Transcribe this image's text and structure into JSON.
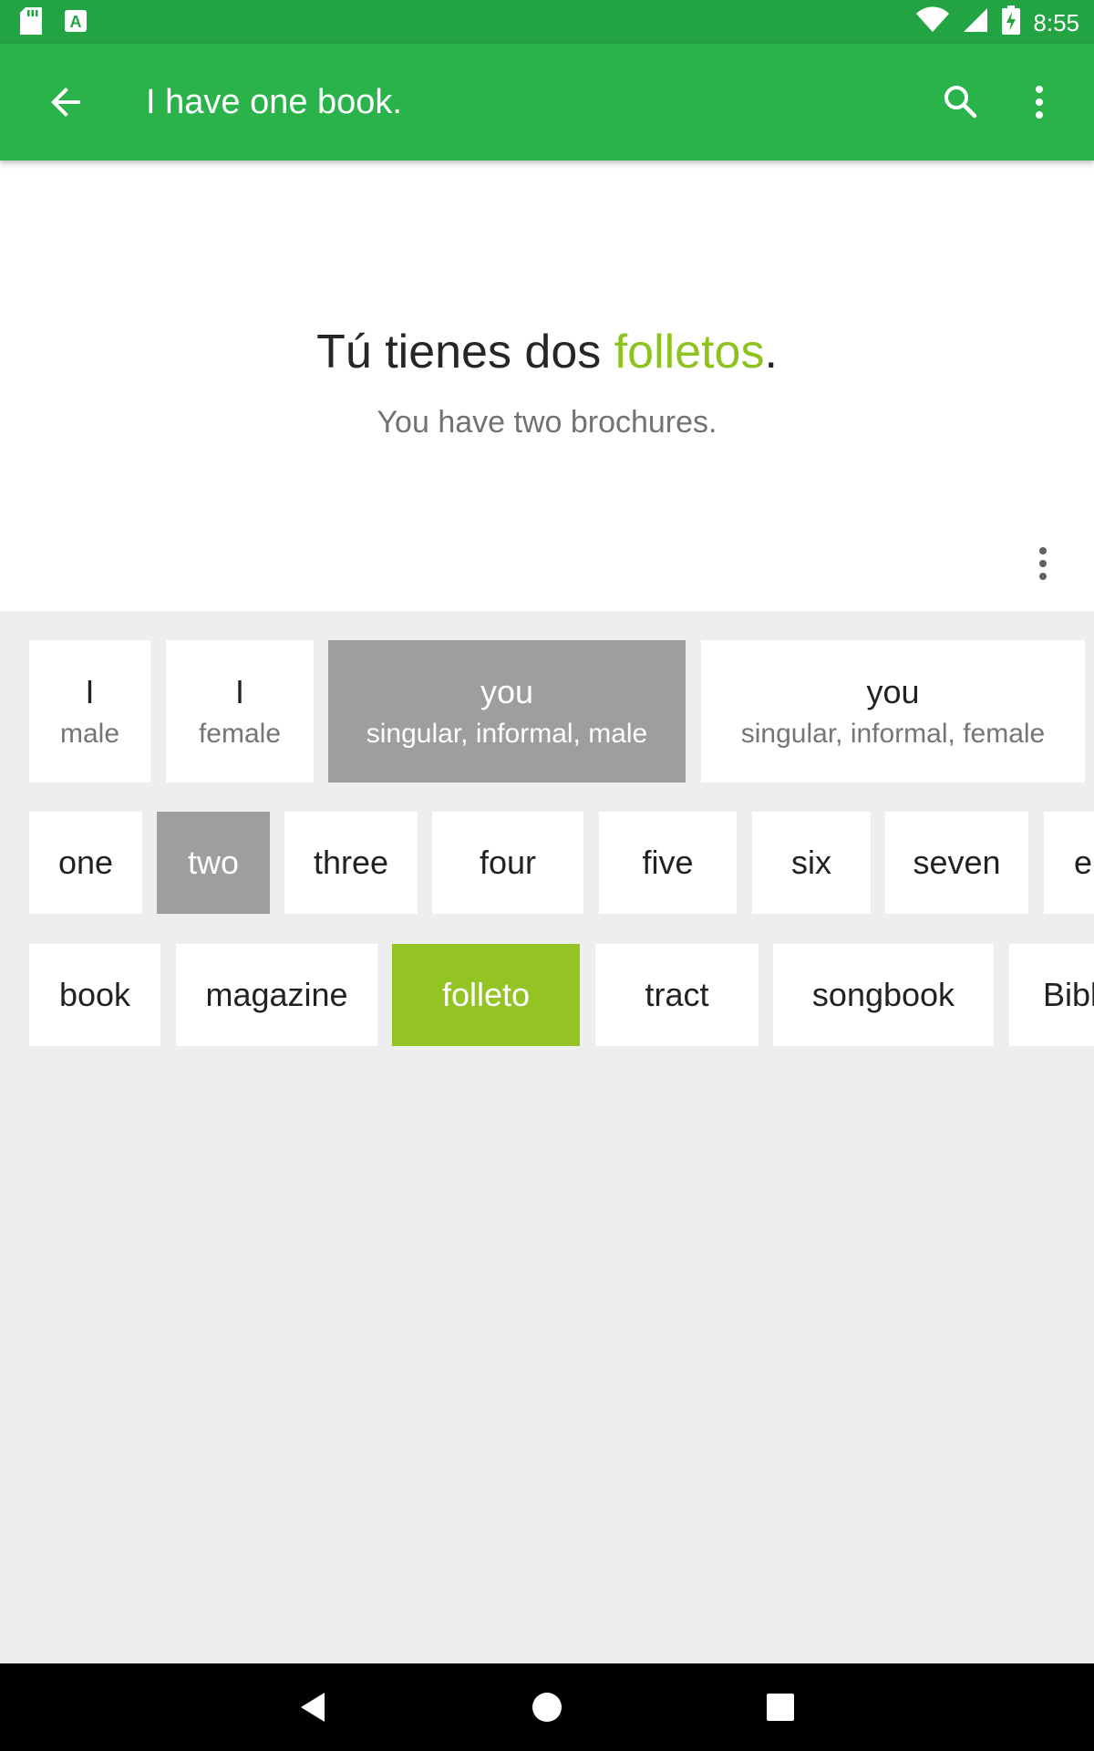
{
  "status_bar": {
    "time": "8:55",
    "icons": [
      "sd-card-icon",
      "keyboard-a-icon",
      "wifi-icon",
      "signal-icon",
      "battery-charging-icon"
    ]
  },
  "app_bar": {
    "title": "I have one book.",
    "back_icon": "arrow-back-icon",
    "search_icon": "search-icon",
    "menu_icon": "more-vert-icon"
  },
  "sentence": {
    "before": "Tú tienes dos ",
    "highlight": "folletos",
    "after": ".",
    "translation": "You have two brochures."
  },
  "pronouns": [
    {
      "label": "I",
      "sub": "male"
    },
    {
      "label": "I",
      "sub": "female"
    },
    {
      "label": "you",
      "sub": "singular, informal, male"
    },
    {
      "label": "you",
      "sub": "singular, informal, female"
    }
  ],
  "numbers": [
    "one",
    "two",
    "three",
    "four",
    "five",
    "six",
    "seven",
    "ei"
  ],
  "nouns": [
    "book",
    "magazine",
    "folleto",
    "tract",
    "songbook",
    "Bibl"
  ],
  "colors": {
    "status_bar": "#23a443",
    "app_bar": "#2bb34b",
    "highlight": "#8dc21f",
    "selected_grey": "#9e9e9e",
    "selected_green": "#93c424"
  }
}
